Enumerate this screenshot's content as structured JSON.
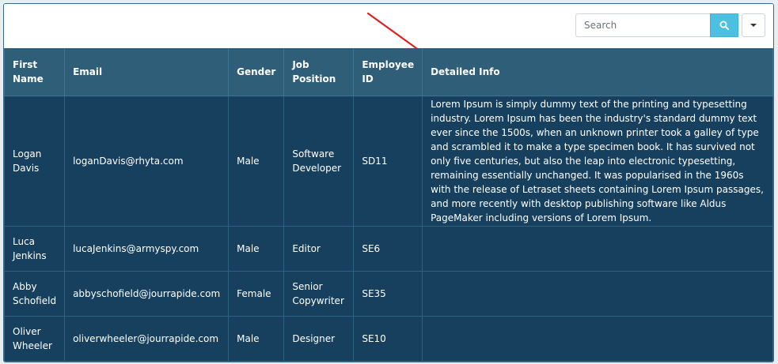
{
  "search": {
    "placeholder": "Search"
  },
  "icons": {
    "search_button": "search-icon",
    "dropdown_button": "caret-down-icon",
    "annotation": "red-arrow"
  },
  "colors": {
    "header_bg": "#2e5e78",
    "row_bg": "#17405e",
    "search_button": "#4bc0e0",
    "annotation_arrow": "#e02020"
  },
  "table": {
    "columns": [
      "First Name",
      "Email",
      "Gender",
      "Job Position",
      "Employee ID",
      "Detailed Info"
    ],
    "rows": [
      {
        "first_name": "Logan Davis",
        "email": "loganDavis@rhyta.com",
        "gender": "Male",
        "job_position": "Software Developer",
        "employee_id": "SD11",
        "detailed_info": "Lorem Ipsum is simply dummy text of the printing and typesetting industry. Lorem Ipsum has been the industry's standard dummy text ever since the 1500s, when an unknown printer took a galley of type and scrambled it to make a type specimen book. It has survived not only five centuries, but also the leap into electronic typesetting, remaining essentially unchanged. It was popularised in the 1960s with the release of Letraset sheets containing Lorem Ipsum passages, and more recently with desktop publishing software like Aldus PageMaker including versions of Lorem Ipsum."
      },
      {
        "first_name": "Luca Jenkins",
        "email": "lucaJenkins@armyspy.com",
        "gender": "Male",
        "job_position": "Editor",
        "employee_id": "SE6",
        "detailed_info": ""
      },
      {
        "first_name": "Abby Schofield",
        "email": "abbyschofield@jourrapide.com",
        "gender": "Female",
        "job_position": "Senior Copywriter",
        "employee_id": "SE35",
        "detailed_info": ""
      },
      {
        "first_name": "Oliver Wheeler",
        "email": "oliverwheeler@jourrapide.com",
        "gender": "Male",
        "job_position": "Designer",
        "employee_id": "SE10",
        "detailed_info": ""
      }
    ]
  }
}
